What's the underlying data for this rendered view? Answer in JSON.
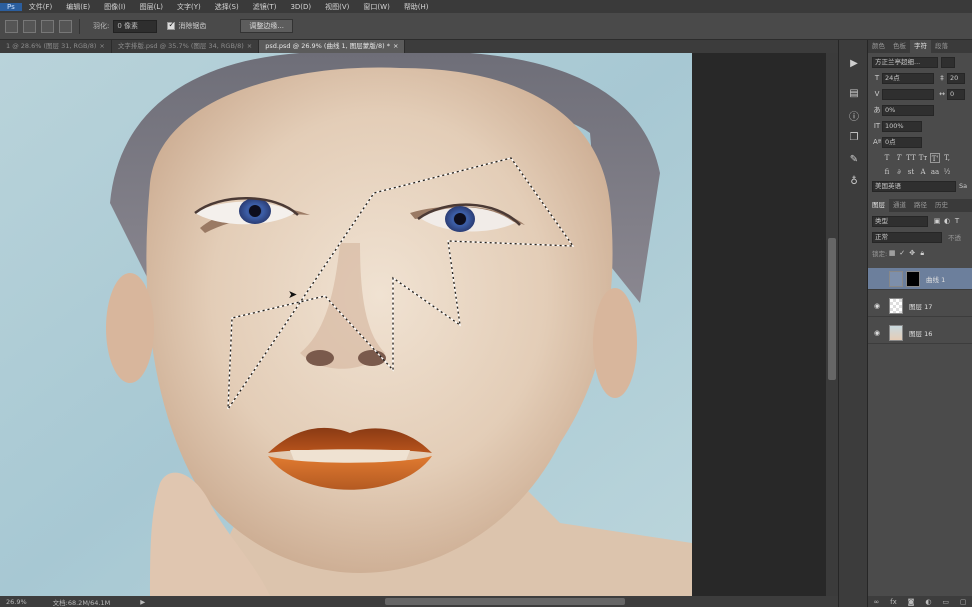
{
  "menu": [
    "文件(F)",
    "编辑(E)",
    "图像(I)",
    "图层(L)",
    "文字(Y)",
    "选择(S)",
    "滤镜(T)",
    "3D(D)",
    "视图(V)",
    "窗口(W)",
    "帮助(H)"
  ],
  "options": {
    "feather_label": "羽化:",
    "feather_value": "0 像素",
    "antialias_label": "消除锯齿",
    "refine_edge_button": "调整边缘..."
  },
  "doc_tabs": [
    {
      "label": "1 @ 28.6% (图层 31, RGB/8)",
      "active": false
    },
    {
      "label": "文字排版.psd @ 35.7% (图层 34, RGB/8)",
      "active": false
    },
    {
      "label": "psd.psd @ 26.9% (曲线 1, 图层蒙版/8) *",
      "active": true
    }
  ],
  "status": {
    "zoom": "26.9%",
    "doc_size": "文档:68.2M/64.1M",
    "arrow": "▶"
  },
  "character_panel": {
    "tabs": [
      "颜色",
      "色板",
      "字符",
      "段落"
    ],
    "active_tab": 2,
    "font_family": "方正兰亭超细...",
    "font_size": "24点",
    "leading": "20",
    "tracking": "0",
    "scale_vertical": "100%",
    "baseline": "0点",
    "horizontal_scale": "0%",
    "language": "美国英语",
    "aa_method": "Sa"
  },
  "layers_panel": {
    "tabs": [
      "图层",
      "通道",
      "路径",
      "历史"
    ],
    "active_tab": 0,
    "filter_kind": "类型",
    "blend_mode": "正常",
    "opacity_label": "不透",
    "lock_label": "锁定:",
    "layers": [
      {
        "name": "曲线 1",
        "visible": false,
        "selected": true,
        "kind": "adjustment"
      },
      {
        "name": "图层 17",
        "visible": true,
        "selected": false,
        "kind": "transparent"
      },
      {
        "name": "图层 16",
        "visible": true,
        "selected": false,
        "kind": "photo"
      }
    ]
  },
  "colors": {
    "menubar": "#3a3a3a",
    "options": "#4a4a4a",
    "panel": "#4b4b4b",
    "selection": "#6c7f9c",
    "lips": "#b8541c"
  }
}
